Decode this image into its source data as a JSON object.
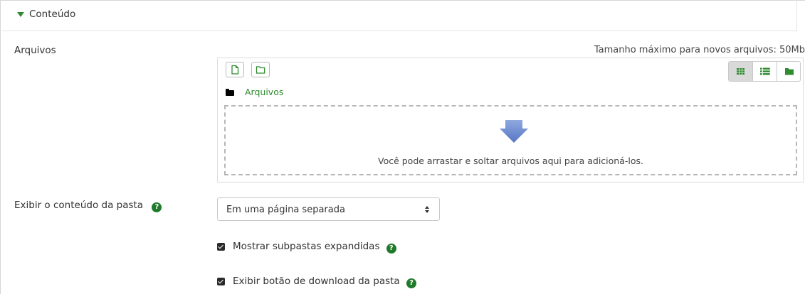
{
  "section": {
    "title": "Conteúdo"
  },
  "files_field": {
    "label": "Arquivos",
    "max_size_text": "Tamanho máximo para novos arquivos: 50Mb",
    "breadcrumb": "Arquivos",
    "dropzone_text": "Você pode arrastar e soltar arquivos aqui para adicioná-los.",
    "toolbar": {
      "add_file_icon": "file-icon",
      "create_folder_icon": "folder-outline-icon"
    },
    "view_modes": [
      {
        "icon": "grid-icon",
        "active": true
      },
      {
        "icon": "list-icon",
        "active": false
      },
      {
        "icon": "tree-folder-icon",
        "active": false
      }
    ]
  },
  "display_field": {
    "label": "Exibir o conteúdo da pasta",
    "help_icon": "question-circle-icon",
    "selected_value": "Em uma página separada"
  },
  "checkboxes": [
    {
      "label": "Mostrar subpastas expandidas",
      "checked": true,
      "help_icon": "question-circle-icon"
    },
    {
      "label": "Exibir botão de download da pasta",
      "checked": true,
      "help_icon": "question-circle-icon"
    }
  ],
  "colors": {
    "accent_green": "#2e8b2e",
    "help_green": "#1f7a2b",
    "active_view_bg": "#d9d9d9"
  }
}
